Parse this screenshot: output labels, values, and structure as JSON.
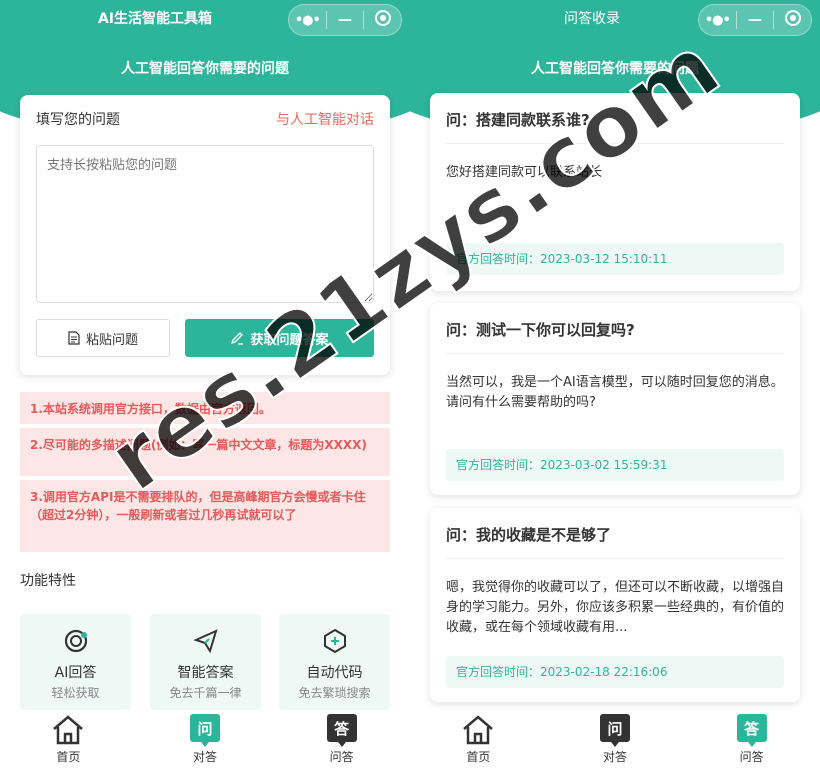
{
  "left": {
    "nav_title": "AI生活智能工具箱",
    "subtitle": "人工智能回答你需要的问题",
    "form": {
      "label": "填写您的问题",
      "ai_link": "与人工智能对话",
      "placeholder": "支持长按粘贴您的问题",
      "paste_label": "粘贴问题",
      "answer_label": "获取问题答案"
    },
    "notices": [
      "1.本站系统调用官方接口，数据由官方返回。",
      "2.尽可能的多描述问题(例如：写一篇中文文章，标题为XXXX)",
      "3.调用官方API是不需要排队的，但是高峰期官方会慢或者卡住（超过2分钟），一般刷新或者过几秒再试就可以了"
    ],
    "features_title": "功能特性",
    "features": [
      {
        "name": "AI回答",
        "desc": "轻松获取"
      },
      {
        "name": "智能答案",
        "desc": "免去千篇一律"
      },
      {
        "name": "自动代码",
        "desc": "免去繁琐搜索"
      }
    ],
    "tabs": [
      {
        "label": "首页",
        "icon": "home-icon"
      },
      {
        "label": "对答",
        "icon": "问"
      },
      {
        "label": "问答",
        "icon": "答"
      }
    ]
  },
  "right": {
    "nav_title": "问答收录",
    "subtitle": "人工智能回答你需要的问题",
    "cards": [
      {
        "q": "问：搭建同款联系谁?",
        "a": "您好搭建同款可以联系站长",
        "time": "官方回答时间：2023-03-12 15:10:11"
      },
      {
        "q": "问：测试一下你可以回复吗?",
        "a": "当然可以，我是一个AI语言模型，可以随时回复您的消息。请问有什么需要帮助的吗?",
        "time": "官方回答时间：2023-03-02 15:59:31"
      },
      {
        "q": "问：我的收藏是不是够了",
        "a": "嗯，我觉得你的收藏可以了，但还可以不断收藏，以增强自身的学习能力。另外，你应该多积累一些经典的，有价值的收藏，或在每个领域收藏有用...",
        "time": "官方回答时间：2023-02-18 22:16:06"
      }
    ],
    "tabs": [
      {
        "label": "首页",
        "icon": "home-icon"
      },
      {
        "label": "对答",
        "icon": "问"
      },
      {
        "label": "问答",
        "icon": "答"
      }
    ]
  },
  "watermark": "res.21zys.com",
  "colors": {
    "accent": "#2db59b",
    "notice_bg": "#fde6e6",
    "notice_text": "#e55a5a",
    "link": "#e66a5c"
  }
}
